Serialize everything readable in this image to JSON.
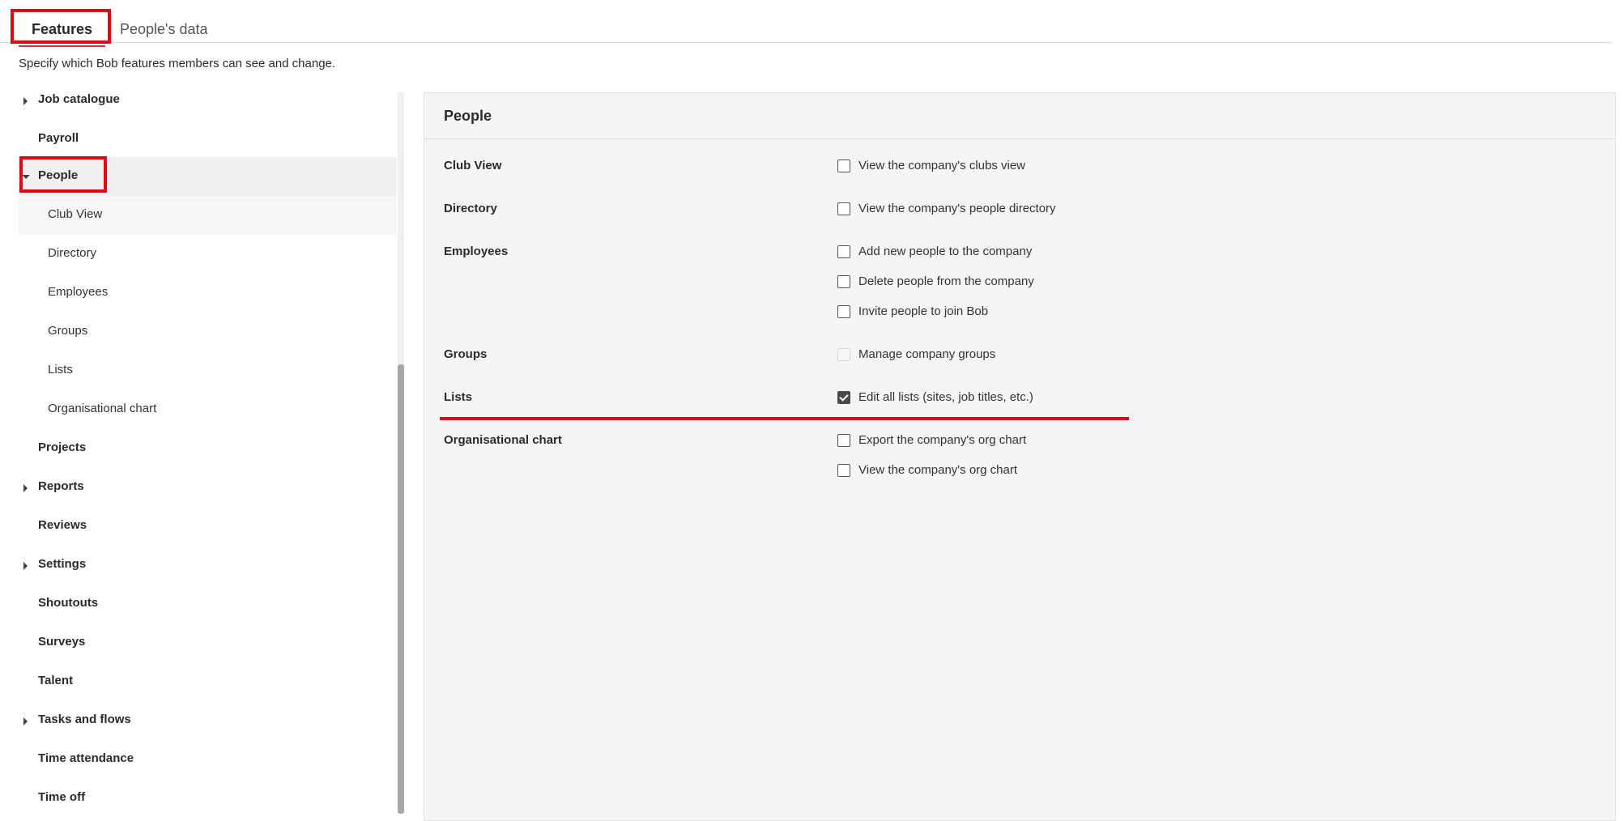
{
  "tabs": [
    {
      "label": "Features",
      "active": true
    },
    {
      "label": "People's data",
      "active": false
    }
  ],
  "subtitle": "Specify which Bob features members can see and change.",
  "sidebar": {
    "items": [
      {
        "label": "Job catalogue",
        "expandable": true
      },
      {
        "label": "Payroll"
      },
      {
        "label": "People",
        "expandable": true,
        "expanded": true
      },
      {
        "label": "Club View",
        "child": true,
        "selected": true
      },
      {
        "label": "Directory",
        "child": true
      },
      {
        "label": "Employees",
        "child": true
      },
      {
        "label": "Groups",
        "child": true
      },
      {
        "label": "Lists",
        "child": true
      },
      {
        "label": "Organisational chart",
        "child": true
      },
      {
        "label": "Projects"
      },
      {
        "label": "Reports",
        "expandable": true
      },
      {
        "label": "Reviews"
      },
      {
        "label": "Settings",
        "expandable": true
      },
      {
        "label": "Shoutouts"
      },
      {
        "label": "Surveys"
      },
      {
        "label": "Talent"
      },
      {
        "label": "Tasks and flows",
        "expandable": true
      },
      {
        "label": "Time attendance"
      },
      {
        "label": "Time off"
      }
    ]
  },
  "panel": {
    "title": "People",
    "sections": [
      {
        "label": "Club View",
        "permissions": [
          {
            "label": "View the company's clubs view",
            "checked": false
          }
        ]
      },
      {
        "label": "Directory",
        "permissions": [
          {
            "label": "View the company's people directory",
            "checked": false
          }
        ]
      },
      {
        "label": "Employees",
        "permissions": [
          {
            "label": "Add new people to the company",
            "checked": false
          },
          {
            "label": "Delete people from the company",
            "checked": false
          },
          {
            "label": "Invite people to join Bob",
            "checked": false
          }
        ]
      },
      {
        "label": "Groups",
        "permissions": [
          {
            "label": "Manage company groups",
            "checked": false,
            "disabled": true
          }
        ]
      },
      {
        "label": "Lists",
        "permissions": [
          {
            "label": "Edit all lists (sites, job titles, etc.)",
            "checked": true
          }
        ]
      },
      {
        "label": "Organisational chart",
        "permissions": [
          {
            "label": "Export the company's org chart",
            "checked": false
          },
          {
            "label": "View the company's org chart",
            "checked": false
          }
        ]
      }
    ]
  },
  "colors": {
    "highlight": "#e30613",
    "tab_underline": "#c7343a",
    "panel_bg": "#f5f5f5"
  }
}
